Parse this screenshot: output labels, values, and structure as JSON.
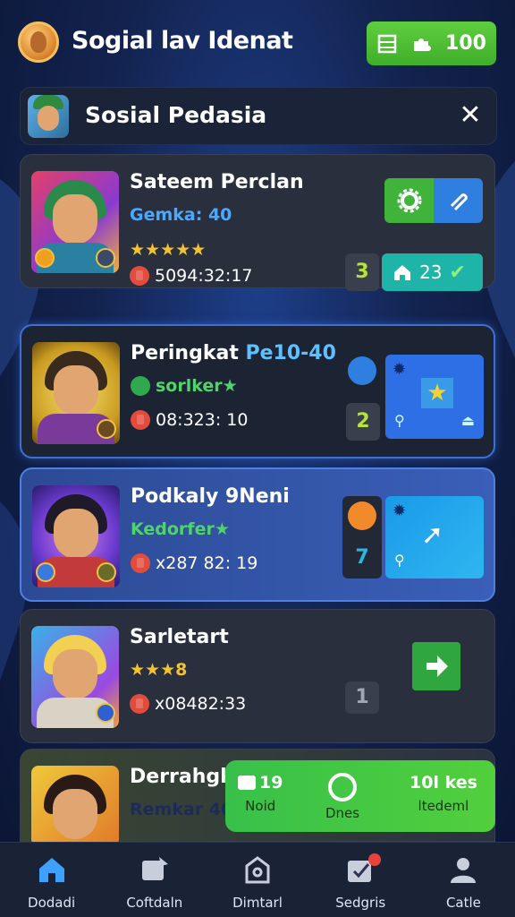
{
  "header": {
    "title": "Sogial lav Idenat",
    "coins_value": "100",
    "accent": "#4cc236"
  },
  "panel": {
    "title": "Sosial Pedasia",
    "close_icon": "close-icon"
  },
  "players": [
    {
      "name": "Sateem Perclan",
      "sub": "Gemka: 40",
      "stars": "★★★★★",
      "meta": "5094:32:17",
      "rank": "3",
      "score": "23"
    },
    {
      "name": "Peringkat ",
      "name_accent": "Pe10-40",
      "sub": "sorlker★",
      "meta": "08:323: 10",
      "rank": "2"
    },
    {
      "name": "Podkaly 9Neni",
      "sub": "Kedorfer★",
      "meta": "x287 82: 19",
      "rank": "7"
    },
    {
      "name": "Sarletart",
      "stars": "★★★8",
      "meta": "x08482:33",
      "rank": "1"
    },
    {
      "name": "Derrahgke",
      "sub": "Remkar 40"
    }
  ],
  "popup": {
    "items": [
      {
        "value": "19",
        "label": "Noid"
      },
      {
        "value": "",
        "label": "Dnes"
      },
      {
        "value": "10l kes",
        "label": "ltedeml"
      }
    ]
  },
  "nav": {
    "items": [
      {
        "label": "Dodadi",
        "icon": "home-icon"
      },
      {
        "label": "Coftdaln",
        "icon": "chat-icon"
      },
      {
        "label": "Dimtarl",
        "icon": "shop-icon"
      },
      {
        "label": "Sedgris",
        "icon": "edit-icon"
      },
      {
        "label": "Catle",
        "icon": "profile-icon"
      }
    ]
  }
}
